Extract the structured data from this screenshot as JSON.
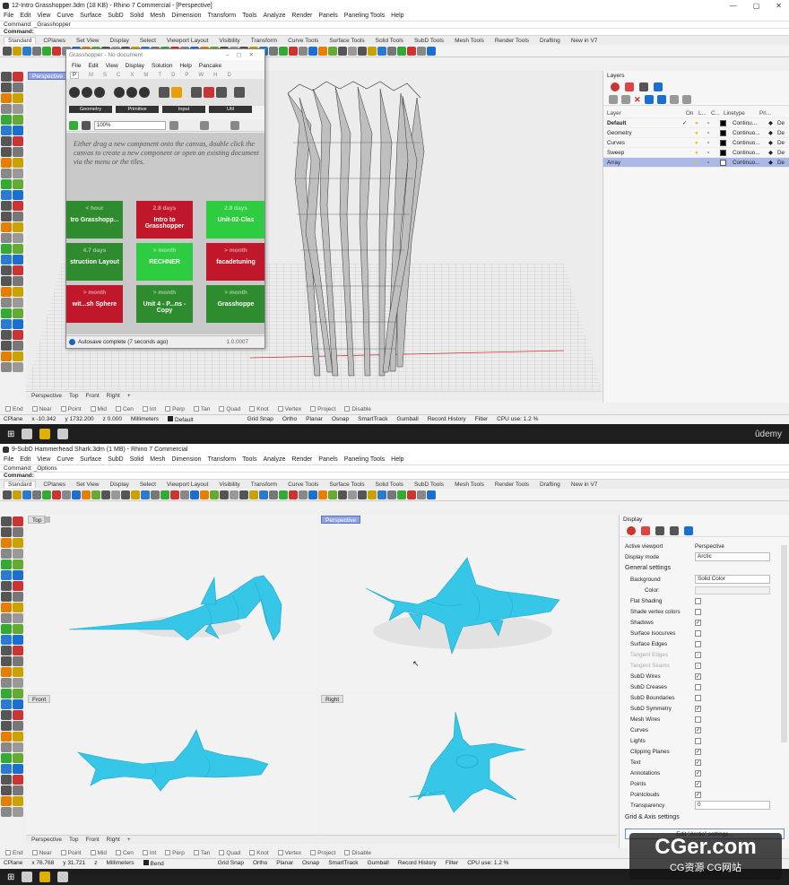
{
  "top": {
    "title": "12-Intro Grasshopper.3dm (18 KB) - Rhino 7 Commercial - [Perspective]",
    "menu": [
      "File",
      "Edit",
      "View",
      "Curve",
      "Surface",
      "SubD",
      "Solid",
      "Mesh",
      "Dimension",
      "Transform",
      "Tools",
      "Analyze",
      "Render",
      "Panels",
      "Paneling Tools",
      "Help"
    ],
    "cmd1": "Command: _Grasshopper",
    "cmd2": "Command:",
    "tabs": [
      "Standard",
      "CPlanes",
      "Set View",
      "Display",
      "Select",
      "Viewport Layout",
      "Visibility",
      "Transform",
      "Curve Tools",
      "Surface Tools",
      "Solid Tools",
      "SubD Tools",
      "Mesh Tools",
      "Render Tools",
      "Drafting",
      "New in V7"
    ],
    "viewport_label": "Perspective",
    "vptabs": [
      "Perspective",
      "Top",
      "Front",
      "Right"
    ],
    "osnaps": [
      "End",
      "Near",
      "Point",
      "Mid",
      "Cen",
      "Int",
      "Perp",
      "Tan",
      "Quad",
      "Knot",
      "Vertex",
      "Project",
      "Disable"
    ],
    "status": {
      "cplane": "CPlane",
      "x": "x -10.342",
      "y": "y 1732.200",
      "z": "z 0.000",
      "units": "Millimeters",
      "layer": "Default",
      "items": [
        "Grid Snap",
        "Ortho",
        "Planar",
        "Osnap",
        "SmartTrack",
        "Gumball",
        "Record History",
        "Filter",
        "CPU use: 1.2 %"
      ]
    },
    "layers_title": "Layers",
    "layers_headers": [
      "Layer",
      "On",
      "L...",
      "C...",
      "Linetype",
      "Pri..."
    ],
    "layers": [
      {
        "name": "Default",
        "linetype": "Continu...",
        "color": "#000000",
        "check": "✓"
      },
      {
        "name": "Geometry",
        "linetype": "Continuo...",
        "color": "#000000",
        "check": ""
      },
      {
        "name": "Curves",
        "linetype": "Continuo...",
        "color": "#000000",
        "check": ""
      },
      {
        "name": "Sweep",
        "linetype": "Continuo...",
        "color": "#000000",
        "check": ""
      },
      {
        "name": "Array",
        "linetype": "Continuo...",
        "color": "#ffffff",
        "check": ""
      }
    ],
    "layers_print": "De"
  },
  "grasshopper": {
    "title": "Grasshopper - No document",
    "menu": [
      "File",
      "Edit",
      "View",
      "Display",
      "Solution",
      "Help",
      "Pancake"
    ],
    "tabs": [
      "P",
      "M",
      "S",
      "C",
      "X",
      "M",
      "T",
      "D",
      "P",
      "W",
      "H",
      "D"
    ],
    "groups": [
      "Geometry",
      "Primitive",
      "Input",
      "Util"
    ],
    "zoom": "100%",
    "hint": "Either drag a new component onto the canvas, double click the canvas to create a new component or open an existing document via the menu or the tiles.",
    "tiles": [
      {
        "time": "< hour",
        "name": "tro Grasshopp...",
        "color": "#2e8b2e"
      },
      {
        "time": "2.8 days",
        "name": "Intro to Grasshopper",
        "color": "#c0182a"
      },
      {
        "time": "2.8 days",
        "name": "Unit-02-Clas",
        "color": "#2ecc40"
      },
      {
        "time": "4.7 days",
        "name": "struction Layout",
        "color": "#2e8b2e"
      },
      {
        "time": "> month",
        "name": "RECHNER",
        "color": "#2ecc40"
      },
      {
        "time": "> month",
        "name": "facadetuning",
        "color": "#c0182a"
      },
      {
        "time": "> month",
        "name": "wit...sh Sphere",
        "color": "#c0182a"
      },
      {
        "time": "> month",
        "name": "Unit 4 - P...ns - Copy",
        "color": "#2e8b2e"
      },
      {
        "time": "> month",
        "name": "Grasshoppe",
        "color": "#2e8b2e"
      }
    ],
    "autosave": "Autosave complete (7 seconds ago)",
    "version": "1.0.0007"
  },
  "bottom": {
    "title": "9-SubD Hammerhead Shark.3dm (1 MB) - Rhino 7 Commercial",
    "cmd1": "Command: _Options",
    "cmd2": "Command:",
    "viewports": [
      "Top",
      "Perspective",
      "Front",
      "Right"
    ],
    "status": {
      "cplane": "CPlane",
      "x": "x 76.768",
      "y": "y 31.721",
      "z": "z",
      "units": "Millimeters",
      "layer": "Bend"
    },
    "display": {
      "title": "Display",
      "active_viewport_label": "Active viewport",
      "active_viewport": "Perspective",
      "display_mode_label": "Display mode",
      "display_mode": "Arctic",
      "general": "General settings",
      "background_label": "Background",
      "background": "Solid Color",
      "color_label": "Color:",
      "settings": [
        {
          "name": "Flat Shading",
          "on": false
        },
        {
          "name": "Shade vertex colors",
          "on": false
        },
        {
          "name": "Shadows",
          "on": true
        },
        {
          "name": "Surface Isocurves",
          "on": false
        },
        {
          "name": "Surface Edges",
          "on": false
        },
        {
          "name": "Tangent Edges",
          "on": true,
          "dim": true
        },
        {
          "name": "Tangent Seams",
          "on": true,
          "dim": true
        },
        {
          "name": "SubD Wires",
          "on": true
        },
        {
          "name": "SubD Creases",
          "on": false
        },
        {
          "name": "SubD Boundaries",
          "on": false
        },
        {
          "name": "SubD Symmetry",
          "on": true
        },
        {
          "name": "Mesh Wires",
          "on": false
        },
        {
          "name": "Curves",
          "on": true
        },
        {
          "name": "Lights",
          "on": false
        },
        {
          "name": "Clipping Planes",
          "on": true
        },
        {
          "name": "Text",
          "on": true
        },
        {
          "name": "Annotations",
          "on": true
        },
        {
          "name": "Points",
          "on": true
        },
        {
          "name": "Pointclouds",
          "on": true
        }
      ],
      "transparency_label": "Transparency",
      "transparency": "0",
      "grid": "Grid & Axis settings",
      "edit_button": "Edit \"Arctic\" settings..."
    }
  },
  "watermark": {
    "udemy": "ûdemy",
    "cg": "CGer.com",
    "cg_sub": "CG资源 CG网站"
  }
}
